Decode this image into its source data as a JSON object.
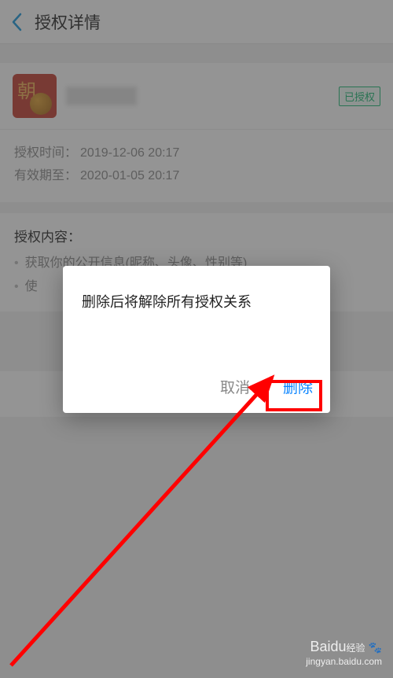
{
  "header": {
    "title": "授权详情"
  },
  "app": {
    "status_badge": "已授权"
  },
  "info": {
    "auth_time_label": "授权时间：",
    "auth_time_value": "2019-12-06 20:17",
    "valid_until_label": "有效期至：",
    "valid_until_value": "2020-01-05 20:17"
  },
  "content": {
    "title": "授权内容：",
    "items": [
      "获取你的公开信息(昵称、头像、性别等)",
      "使"
    ]
  },
  "dialog": {
    "message": "删除后将解除所有授权关系",
    "cancel": "取消",
    "delete": "删除"
  },
  "watermark": {
    "brand": "Baidu",
    "brand_cn": "经验",
    "site": "jingyan.baidu.com"
  }
}
